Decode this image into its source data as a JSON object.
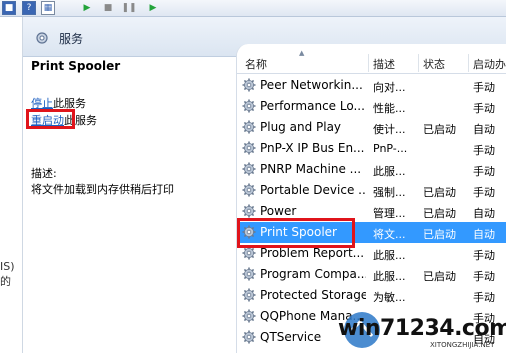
{
  "header": {
    "title": "服务"
  },
  "left_fragment": "IS)的",
  "detail": {
    "service_name": "Print Spooler",
    "stop_link": "停止",
    "stop_suffix": "此服务",
    "restart_link": "重启动",
    "restart_suffix": "此服务",
    "description_label": "描述:",
    "description_text": "将文件加载到内存供稍后打印"
  },
  "columns": {
    "name": "名称",
    "description": "描述",
    "status": "状态",
    "startup": "启动办"
  },
  "services": [
    {
      "name": "Peer Networkin...",
      "description": "向对...",
      "status": "",
      "startup": "手动"
    },
    {
      "name": "Performance Lo...",
      "description": "性能...",
      "status": "",
      "startup": "手动"
    },
    {
      "name": "Plug and Play",
      "description": "使计...",
      "status": "已启动",
      "startup": "自动"
    },
    {
      "name": "PnP-X IP Bus En...",
      "description": "PnP-...",
      "status": "",
      "startup": "手动"
    },
    {
      "name": "PNRP Machine ...",
      "description": "此服...",
      "status": "",
      "startup": "手动"
    },
    {
      "name": "Portable Device ...",
      "description": "强制...",
      "status": "已启动",
      "startup": "手动"
    },
    {
      "name": "Power",
      "description": "管理...",
      "status": "已启动",
      "startup": "自动"
    },
    {
      "name": "Print Spooler",
      "description": "将文...",
      "status": "已启动",
      "startup": "自动",
      "selected": true
    },
    {
      "name": "Problem Report...",
      "description": "此服...",
      "status": "",
      "startup": "手动"
    },
    {
      "name": "Program Compa...",
      "description": "此服...",
      "status": "已启动",
      "startup": "手动"
    },
    {
      "name": "Protected Storage",
      "description": "为敏...",
      "status": "",
      "startup": "手动"
    },
    {
      "name": "QQPhone Mana...",
      "description": "",
      "status": "",
      "startup": "手动"
    },
    {
      "name": "QTService",
      "description": "",
      "status": "",
      "startup": "自动"
    }
  ],
  "watermark": {
    "text": "win71234.com",
    "sub": "XITONGZHIJIA.NET"
  },
  "colors": {
    "selection": "#3399ff",
    "highlight_box": "#e0141b",
    "link": "#1a5dc0"
  }
}
